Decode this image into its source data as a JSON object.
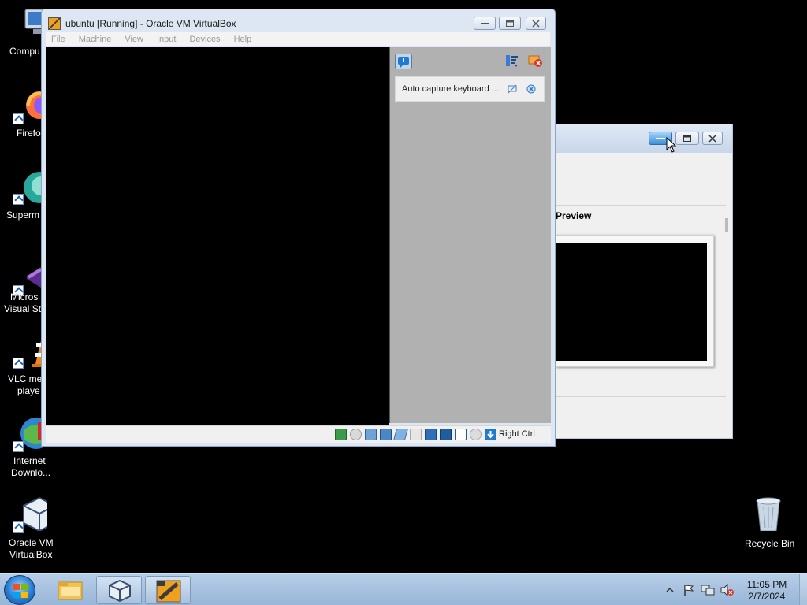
{
  "desktop": {
    "icons": [
      {
        "label": "Compu",
        "icon": "computer-icon"
      },
      {
        "label": "Firefo",
        "icon": "firefox-icon"
      },
      {
        "label": "Superm",
        "icon": "supermium-icon"
      },
      {
        "label": "Micros\nVisual St",
        "label1": "Micros",
        "label2": "Visual St",
        "icon": "visual-studio-icon"
      },
      {
        "label1": "VLC me",
        "label2": "playe",
        "icon": "vlc-icon"
      },
      {
        "label1": "Internet",
        "label2": "Downlo...",
        "icon": "internet-download-manager-icon"
      },
      {
        "label1": "Oracle VM",
        "label2": "VirtualBox",
        "icon": "virtualbox-icon"
      },
      {
        "label": "Recycle Bin",
        "icon": "recycle-bin-icon"
      }
    ]
  },
  "bg_window": {
    "preview_label": "Preview"
  },
  "vm_window": {
    "title": "ubuntu [Running] - Oracle VM VirtualBox",
    "menu": [
      "File",
      "Machine",
      "View",
      "Input",
      "Devices",
      "Help"
    ],
    "notification": "Auto capture keyboard ...",
    "host_key": "Right Ctrl"
  },
  "taskbar": {
    "time": "11:05 PM",
    "date": "2/7/2024"
  },
  "colors": {
    "taskbar": "#a7c0de",
    "vm_panel": "#b1b1b1",
    "desktop": "#000000"
  }
}
